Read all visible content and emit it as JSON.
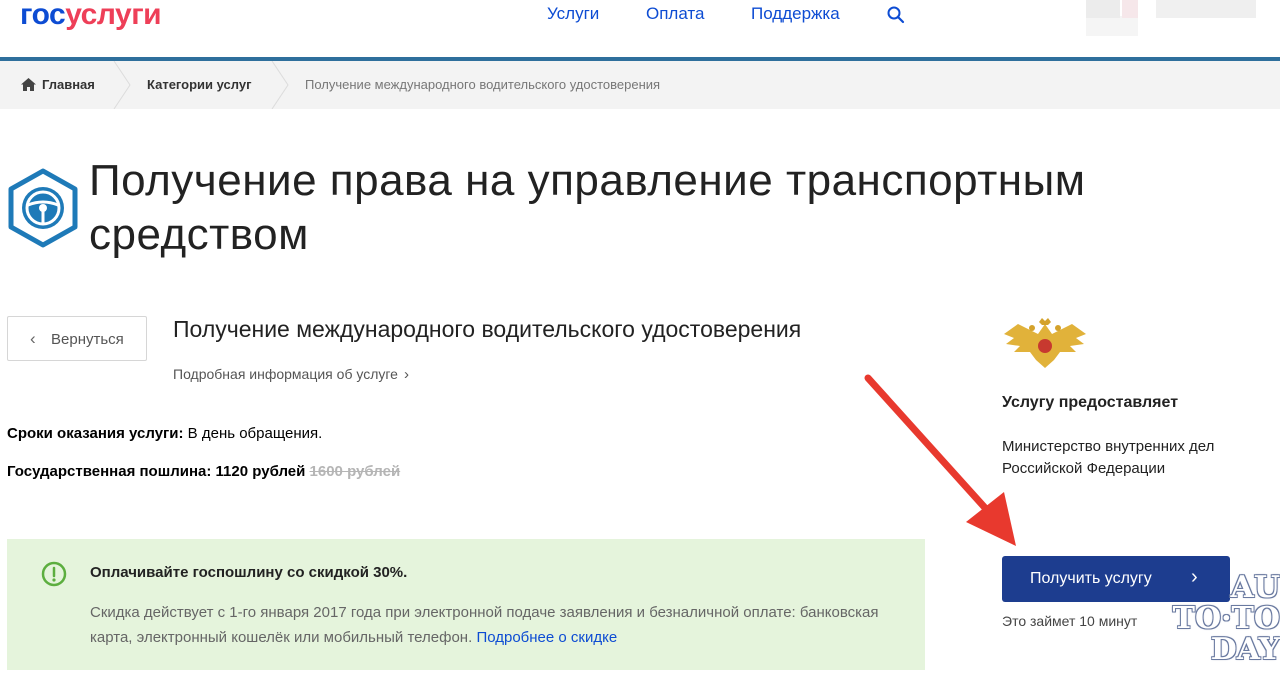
{
  "header": {
    "logo_part1": "гос",
    "logo_part2": "услуги",
    "nav": [
      "Услуги",
      "Оплата",
      "Поддержка"
    ],
    "search_icon": "search-icon"
  },
  "breadcrumb": {
    "home_icon": "home-icon",
    "items": [
      "Главная",
      "Категории услуг",
      "Получение международного водительского удостоверения"
    ]
  },
  "title": {
    "icon": "steering-wheel-icon",
    "text": "Получение права на управление транспортным средством"
  },
  "service": {
    "back_label": "Вернуться",
    "subtitle": "Получение международного водительского удостоверения",
    "more_info": "Подробная информация об услуге",
    "terms_label": "Сроки оказания услуги:",
    "terms_value": "В день обращения.",
    "fee_label": "Государственная пошлина:",
    "fee_value": "1120 рублей",
    "fee_old": "1600 рублей"
  },
  "discount": {
    "icon": "exclamation-circle-icon",
    "title": "Оплачивайте госпошлину со скидкой 30%.",
    "text": "Скидка действует с 1-го января 2017 года при электронной подаче заявления и безналичной оплате: банковская карта, электронный кошелёк или мобильный телефон.",
    "link": "Подробнее о скидке",
    "bg_color": "#e5f4dc"
  },
  "provider": {
    "emblem": "double-headed-eagle-emblem",
    "heading": "Услугу предоставляет",
    "name": "Министерство внутренних дел Российской Федерации"
  },
  "action": {
    "button_label": "Получить услугу",
    "duration": "Это займет 10 минут",
    "button_color": "#1d3d8f"
  },
  "watermark": [
    "AU",
    "TO·TO",
    "DAY"
  ],
  "colors": {
    "accent": "#0d4cd3",
    "logo_red": "#ee3f58",
    "arrow": "#e8392e"
  }
}
